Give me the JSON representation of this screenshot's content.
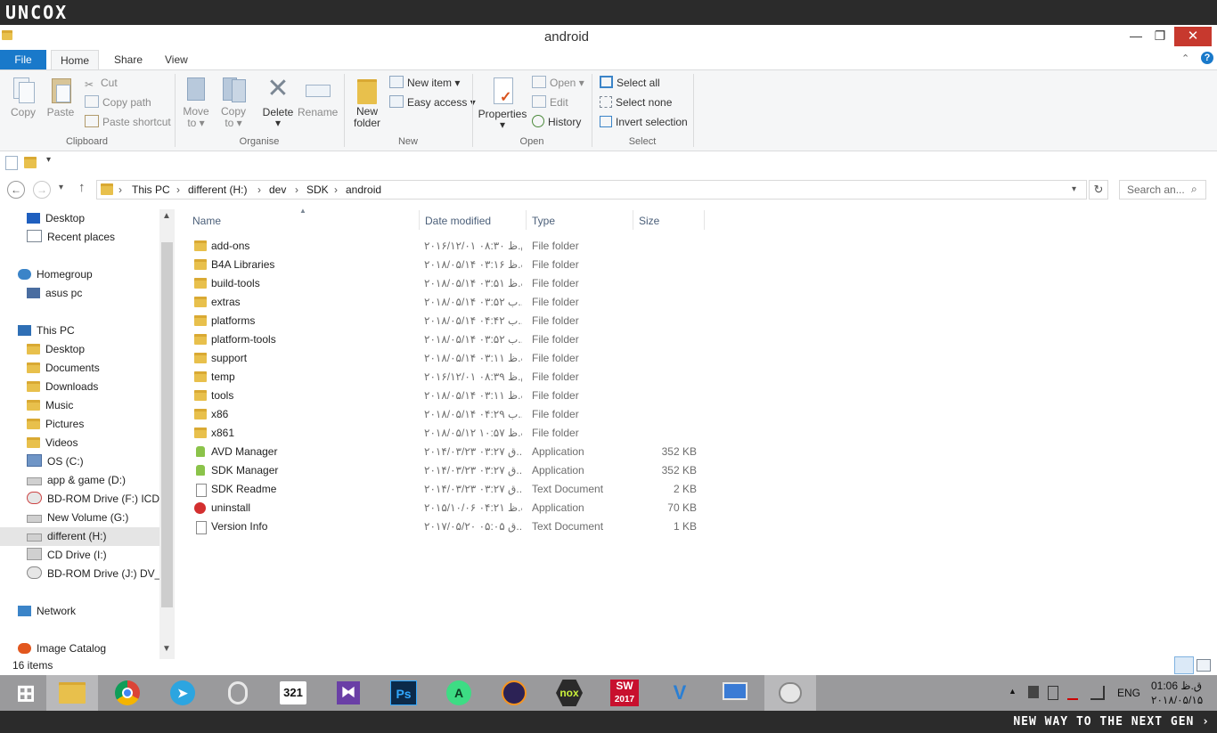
{
  "brand": {
    "logo_text": "UNCOX",
    "slogan": "NEW WAY TO THE NEXT GEN ›"
  },
  "window": {
    "title": "android",
    "minimize": "—",
    "maximize": "❐",
    "close": "✕"
  },
  "ribbon": {
    "tabs": [
      {
        "label": "File"
      },
      {
        "label": "Home"
      },
      {
        "label": "Share"
      },
      {
        "label": "View"
      }
    ],
    "clipboard": {
      "group_label": "Clipboard",
      "copy": "Copy",
      "paste": "Paste",
      "cut": "Cut",
      "copy_path": "Copy path",
      "paste_shortcut": "Paste shortcut"
    },
    "organise": {
      "group_label": "Organise",
      "move_to": "Move to",
      "copy_to": "Copy to",
      "delete": "Delete",
      "rename": "Rename"
    },
    "new": {
      "group_label": "New",
      "new_folder_l1": "New",
      "new_folder_l2": "folder",
      "new_item": "New item",
      "easy_access": "Easy access"
    },
    "open": {
      "group_label": "Open",
      "properties": "Properties",
      "open": "Open",
      "edit": "Edit",
      "history": "History"
    },
    "select": {
      "group_label": "Select",
      "select_all": "Select all",
      "select_none": "Select none",
      "invert_selection": "Invert selection"
    }
  },
  "address": {
    "crumbs": [
      "This PC",
      "different (H:)",
      "dev",
      "SDK",
      "android"
    ],
    "search_placeholder": "Search an..."
  },
  "nav": {
    "items": [
      {
        "label": "Desktop"
      },
      {
        "label": "Recent places"
      },
      {
        "label": "Homegroup"
      },
      {
        "label": "asus pc"
      },
      {
        "label": "This PC"
      },
      {
        "label": "Desktop"
      },
      {
        "label": "Documents"
      },
      {
        "label": "Downloads"
      },
      {
        "label": "Music"
      },
      {
        "label": "Pictures"
      },
      {
        "label": "Videos"
      },
      {
        "label": "OS (C:)"
      },
      {
        "label": "app & game (D:)"
      },
      {
        "label": "BD-ROM Drive (F:) ICDL"
      },
      {
        "label": "New Volume (G:)"
      },
      {
        "label": "different (H:)"
      },
      {
        "label": "CD Drive (I:)"
      },
      {
        "label": "BD-ROM Drive (J:) DV_LS"
      },
      {
        "label": "Network"
      },
      {
        "label": "Image Catalog"
      }
    ]
  },
  "columns": {
    "name": "Name",
    "date": "Date modified",
    "type": "Type",
    "size": "Size"
  },
  "files": [
    {
      "name": "add-ons",
      "date": "۲۰۱۶/۱۲/۰۱ ق.ظ ۰۸:۳۰",
      "type": "File folder",
      "size": "",
      "icon": "folder-icon"
    },
    {
      "name": "B4A Libraries",
      "date": "۲۰۱۸/۰۵/۱۴ ب.ظ ۰۳:۱۶",
      "type": "File folder",
      "size": "",
      "icon": "folder-icon"
    },
    {
      "name": "build-tools",
      "date": "۲۰۱۸/۰۵/۱۴ ب.ظ ۰۳:۵۱",
      "type": "File folder",
      "size": "",
      "icon": "folder-icon"
    },
    {
      "name": "extras",
      "date": "۲۰۱۸/۰۵/۱۴ ب ۰۳:۵۲...",
      "type": "File folder",
      "size": "",
      "icon": "folder-icon"
    },
    {
      "name": "platforms",
      "date": "۲۰۱۸/۰۵/۱۴ ب ۰۴:۴۲...",
      "type": "File folder",
      "size": "",
      "icon": "folder-icon"
    },
    {
      "name": "platform-tools",
      "date": "۲۰۱۸/۰۵/۱۴ ب ۰۳:۵۲...",
      "type": "File folder",
      "size": "",
      "icon": "folder-icon"
    },
    {
      "name": "support",
      "date": "۲۰۱۸/۰۵/۱۴ ب.ظ ۰۳:۱۱",
      "type": "File folder",
      "size": "",
      "icon": "folder-icon"
    },
    {
      "name": "temp",
      "date": "۲۰۱۶/۱۲/۰۱ ق.ظ ۰۸:۳۹",
      "type": "File folder",
      "size": "",
      "icon": "folder-icon"
    },
    {
      "name": "tools",
      "date": "۲۰۱۸/۰۵/۱۴ ب.ظ ۰۳:۱۱",
      "type": "File folder",
      "size": "",
      "icon": "folder-icon"
    },
    {
      "name": "x86",
      "date": "۲۰۱۸/۰۵/۱۴ ب ۰۴:۲۹...",
      "type": "File folder",
      "size": "",
      "icon": "folder-icon"
    },
    {
      "name": "x861",
      "date": "۲۰۱۸/۰۵/۱۲ ب.ظ ۱۰:۵۷",
      "type": "File folder",
      "size": "",
      "icon": "folder-icon"
    },
    {
      "name": "AVD Manager",
      "date": "۲۰۱۴/۰۳/۲۳ ق ۰۳:۲۷...",
      "type": "Application",
      "size": "352 KB",
      "icon": "android-app-icon"
    },
    {
      "name": "SDK Manager",
      "date": "۲۰۱۴/۰۳/۲۳ ق ۰۳:۲۷...",
      "type": "Application",
      "size": "352 KB",
      "icon": "android-app-icon"
    },
    {
      "name": "SDK Readme",
      "date": "۲۰۱۴/۰۳/۲۳ ق ۰۳:۲۷...",
      "type": "Text Document",
      "size": "2 KB",
      "icon": "text-document-icon"
    },
    {
      "name": "uninstall",
      "date": "۲۰۱۵/۱۰/۰۶ ب.ظ ۰۴:۲۱",
      "type": "Application",
      "size": "70 KB",
      "icon": "uninstall-app-icon"
    },
    {
      "name": "Version Info",
      "date": "۲۰۱۷/۰۵/۲۰ ق ۰۵:۰۵...",
      "type": "Text Document",
      "size": "1 KB",
      "icon": "text-document-icon"
    }
  ],
  "status": {
    "item_count": "16 items"
  },
  "taskbar": {
    "apps": [
      {
        "name": "start-button",
        "glyph": "⊞"
      },
      {
        "name": "file-explorer-icon",
        "glyph": ""
      },
      {
        "name": "chrome-icon",
        "glyph": ""
      },
      {
        "name": "telegram-icon",
        "glyph": ""
      },
      {
        "name": "opera-icon",
        "glyph": "O"
      },
      {
        "name": "321-player-icon",
        "glyph": "321"
      },
      {
        "name": "visual-studio-icon",
        "glyph": ""
      },
      {
        "name": "photoshop-icon",
        "glyph": "Ps"
      },
      {
        "name": "android-studio-icon",
        "glyph": ""
      },
      {
        "name": "eclipse-icon",
        "glyph": ""
      },
      {
        "name": "nox-icon",
        "glyph": "nox"
      },
      {
        "name": "solidworks-icon",
        "glyph": "SW"
      },
      {
        "name": "v-app-icon",
        "glyph": "V"
      },
      {
        "name": "remote-desktop-icon",
        "glyph": ""
      },
      {
        "name": "paint-icon",
        "glyph": ""
      }
    ],
    "sw_year": "2017",
    "language": "ENG",
    "time": "ق.ظ 01:06",
    "date": "۲۰۱۸/۰۵/۱۵"
  }
}
